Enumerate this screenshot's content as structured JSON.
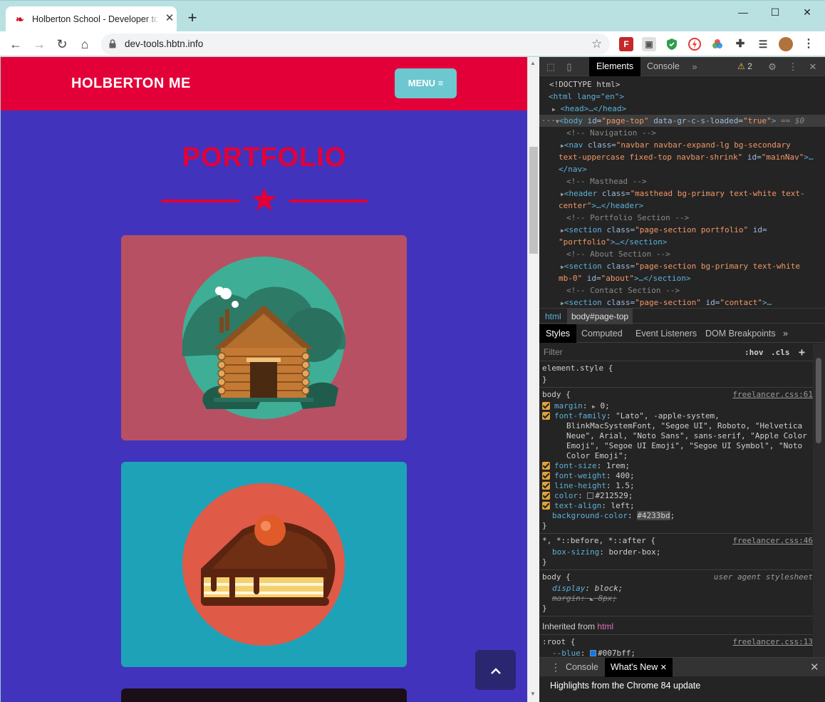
{
  "browser": {
    "tab_title": "Holberton School - Developer to",
    "url": "dev-tools.hbtn.info",
    "new_tab": "+",
    "tab_close": "✕",
    "window_controls": [
      "—",
      "☐",
      "✕"
    ]
  },
  "page": {
    "brand": "HOLBERTON ME",
    "menu_label": "MENU ≡",
    "section_title": "PORTFOLIO",
    "scroll_top_icon": "chevron-up-icon",
    "colors": {
      "navbar": "#e30038",
      "body": "#4233bd",
      "menu": "#6cc7d0",
      "card1": "#b85064",
      "card2": "#1ea2b8"
    }
  },
  "devtools": {
    "tabs": [
      "Elements",
      "Console"
    ],
    "warnings": "2",
    "dom": {
      "doctype": "<!DOCTYPE html>",
      "html_open": "<html lang=\"en\">",
      "head": "<head>…</head>",
      "body_tag": "body",
      "body_id_attr": "id",
      "body_id_val": "\"page-top\"",
      "body_gr_attr": "data-gr-c-s-loaded",
      "body_gr_val": "\"true\"",
      "body_eq": "== $0",
      "c_nav": "<!-- Navigation -->",
      "nav_line1_a": "<nav",
      "nav_class": "class=",
      "nav_class_val": "\"navbar navbar-expand-lg bg-secondary",
      "nav_line2": "text-uppercase fixed-top navbar-shrink\"",
      "nav_id": "id=",
      "nav_id_val": "\"mainNav\"",
      "nav_end": "</nav>",
      "c_masthead": "<!-- Masthead -->",
      "header_class_val": "\"masthead bg-primary text-white text-",
      "header_line2": "center\"",
      "header_end": "…</header>",
      "c_portfolio": "<!-- Portfolio Section -->",
      "sec1_class_val": "\"page-section portfolio\"",
      "sec1_id_val": "\"portfolio\"",
      "sec_end": "…</section>",
      "c_about": "<!-- About Section -->",
      "sec2_class_val": "\"page-section bg-primary text-white",
      "sec2_line2": "mb-0\"",
      "sec2_id_val": "\"about\"",
      "c_contact": "<!-- Contact Section -->",
      "sec3_class_val": "\"page-section\"",
      "sec3_id_val": "\"contact\""
    },
    "breadcrumbs": [
      "html",
      "body#page-top"
    ],
    "styles_tabs": [
      "Styles",
      "Computed",
      "Event Listeners",
      "DOM Breakpoints"
    ],
    "filter_placeholder": "Filter",
    "filter_hov": ":hov",
    "filter_cls": ".cls",
    "rules": {
      "element_style": "element.style {",
      "close": "}",
      "body_sel": "body {",
      "body_src": "freelancer.css:61",
      "margin": "margin",
      "margin_val": "0;",
      "ff": "font-family",
      "ff_val1": "\"Lato\", -apple-system,",
      "ff_val2": "BlinkMacSystemFont, \"Segoe UI\", Roboto, \"Helvetica",
      "ff_val3": "Neue\", Arial, \"Noto Sans\", sans-serif, \"Apple Color",
      "ff_val4": "Emoji\", \"Segoe UI Emoji\", \"Segoe UI Symbol\", \"Noto",
      "ff_val5": "Color Emoji\";",
      "fs": "font-size",
      "fs_val": "1rem;",
      "fw": "font-weight",
      "fw_val": "400;",
      "lh": "line-height",
      "lh_val": "1.5;",
      "color": "color",
      "color_val": "#212529;",
      "ta": "text-align",
      "ta_val": "left;",
      "bg": "background-color",
      "bg_val": "#4233bd",
      "univ_sel": "*, *::before, *::after {",
      "univ_src": "freelancer.css:46",
      "bs": "box-sizing",
      "bs_val": "border-box;",
      "ua_sel": "body {",
      "ua_src": "user agent stylesheet",
      "disp": "display",
      "disp_val": "block;",
      "ua_margin": "margin",
      "ua_margin_val": "8px;",
      "inherited": "Inherited from",
      "inherited_tag": "html",
      "root_sel": ":root {",
      "root_src": "freelancer.css:13",
      "blue": "--blue",
      "blue_val": "#007bff;"
    },
    "drawer_tabs": [
      "Console",
      "What's New"
    ],
    "drawer_message": "Highlights from the Chrome 84 update"
  }
}
